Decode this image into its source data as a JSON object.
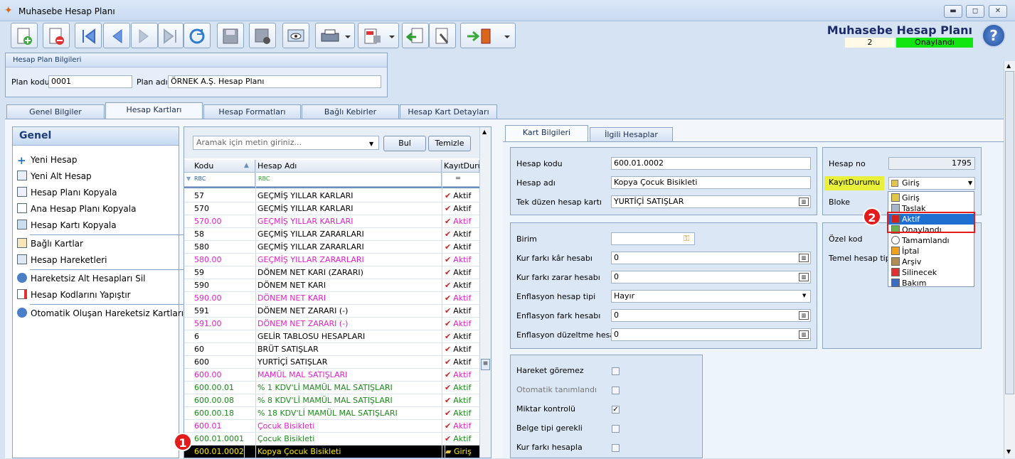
{
  "window": {
    "title": "Muhasebe Hesap Planı",
    "minimize": "▬",
    "maximize": "◻",
    "close": "✕"
  },
  "header": {
    "title": "Muhasebe Hesap Planı",
    "number": "2",
    "status": "Onaylandı",
    "help": "?"
  },
  "plan": {
    "section_title": "Hesap Plan Bilgileri",
    "code_label": "Plan kodu",
    "code_value": "0001",
    "name_label": "Plan adı",
    "name_value": "ÖRNEK A.Ş. Hesap Planı"
  },
  "tabs": [
    "Genel Bilgiler",
    "Hesap Kartları",
    "Hesap Formatları",
    "Bağlı Kebirler",
    "Hesap Kart Detayları"
  ],
  "sidebar": {
    "title": "Genel",
    "items": [
      "Yeni Hesap",
      "Yeni Alt Hesap",
      "Hesap Planı Kopyala",
      "Ana Hesap Planı Kopyala",
      "Hesap Kartı Kopyala",
      "Bağlı Kartlar",
      "Hesap Hareketleri",
      "Hareketsiz Alt Hesapları Sil",
      "Hesap Kodlarını Yapıştır",
      "Otomatik Oluşan Hareketsiz Kartları Sil"
    ]
  },
  "grid": {
    "search_placeholder": "Aramak için metin giriniz...",
    "find_button": "Bul",
    "clear_button": "Temizle",
    "columns": [
      "Kodu",
      "Hesap Adı",
      "KayıtDurur"
    ],
    "filter_icon": "RBC",
    "rows": [
      {
        "code": "57",
        "name": "GEÇMİŞ YILLAR KARLARI",
        "status": "Aktif",
        "color": "#000000"
      },
      {
        "code": "570",
        "name": "GEÇMİŞ YILLAR KARLARI",
        "status": "Aktif",
        "color": "#000000"
      },
      {
        "code": "570.00",
        "name": "GEÇMİŞ YILLAR KARLARI",
        "status": "Aktif",
        "color": "#e020c8"
      },
      {
        "code": "58",
        "name": "GEÇMİŞ YILLAR ZARARLARI",
        "status": "Aktif",
        "color": "#000000"
      },
      {
        "code": "580",
        "name": "GEÇMİŞ YILLAR ZARARLARI",
        "status": "Aktif",
        "color": "#000000"
      },
      {
        "code": "580.00",
        "name": "GEÇMİŞ YILLAR ZARARLARI",
        "status": "Aktif",
        "color": "#e020c8"
      },
      {
        "code": "59",
        "name": "DÖNEM NET KARI (ZARARI)",
        "status": "Aktif",
        "color": "#000000"
      },
      {
        "code": "590",
        "name": "DÖNEM NET KARI",
        "status": "Aktif",
        "color": "#000000"
      },
      {
        "code": "590.00",
        "name": "DÖNEM NET KARI",
        "status": "Aktif",
        "color": "#e020c8"
      },
      {
        "code": "591",
        "name": "DÖNEM NET ZARARI (-)",
        "status": "Aktif",
        "color": "#000000"
      },
      {
        "code": "591.00",
        "name": "DÖNEM NET ZARARI (-)",
        "status": "Aktif",
        "color": "#e020c8"
      },
      {
        "code": "6",
        "name": "GELİR TABLOSU HESAPLARI",
        "status": "Aktif",
        "color": "#000000"
      },
      {
        "code": "60",
        "name": "BRÜT SATIŞLAR",
        "status": "Aktif",
        "color": "#000000"
      },
      {
        "code": "600",
        "name": "YURTİÇİ SATIŞLAR",
        "status": "Aktif",
        "color": "#000000"
      },
      {
        "code": "600.00",
        "name": "MAMÜL MAL SATIŞLARI",
        "status": "Aktif",
        "color": "#e020c8"
      },
      {
        "code": "600.00.01",
        "name": "% 1 KDV'Lİ MAMÜL MAL SATIŞLARI",
        "status": "Aktif",
        "color": "#1a8a1a"
      },
      {
        "code": "600.00.08",
        "name": "% 8 KDV'Lİ MAMÜL MAL SATIŞLARI",
        "status": "Aktif",
        "color": "#1a8a1a"
      },
      {
        "code": "600.00.18",
        "name": "% 18 KDV'Lİ MAMÜL MAL SATIŞLARI",
        "status": "Aktif",
        "color": "#1a8a1a"
      },
      {
        "code": "600.01",
        "name": "Çocuk Bisikleti",
        "status": "Aktif",
        "color": "#e020c8"
      },
      {
        "code": "600.01.0001",
        "name": "Çocuk Bisikleti",
        "status": "Aktif",
        "color": "#1a8a1a"
      },
      {
        "code": "600.01.0002",
        "name": "Kopya Çocuk Bisikleti",
        "status": "Giriş",
        "color": "#ffee00"
      }
    ]
  },
  "detail": {
    "tabs": [
      "Kart Bilgileri",
      "İlgili Hesaplar"
    ],
    "hesap_kodu_label": "Hesap kodu",
    "hesap_kodu": "600.01.0002",
    "hesap_adi_label": "Hesap adı",
    "hesap_adi": "Kopya Çocuk Bisikleti",
    "tek_duzen_label": "Tek düzen hesap kartı",
    "tek_duzen": "YURTİÇİ SATIŞLAR",
    "hesap_no_label": "Hesap no",
    "hesap_no": "1795",
    "kayit_durumu_label": "KayıtDurumu",
    "kayit_durumu": "Giriş",
    "bloke_label": "Bloke",
    "birim_label": "Birim",
    "kur_kar_label": "Kur farkı kâr hesabı",
    "kur_kar": "0",
    "kur_zarar_label": "Kur farkı zarar hesabı",
    "kur_zarar": "0",
    "enf_tipi_label": "Enflasyon hesap tipi",
    "enf_tipi": "Hayır",
    "enf_fark_label": "Enflasyon fark hesabı",
    "enf_fark": "0",
    "enf_duz_label": "Enflasyon düzeltme hesabı",
    "enf_duz": "0",
    "ozel_kod_label": "Özel kod",
    "temel_tipi_label": "Temel hesap tipi",
    "checks": [
      {
        "label": "Hareket göremez",
        "checked": false,
        "dim": false
      },
      {
        "label": "Otomatik tanımlandı",
        "checked": false,
        "dim": true
      },
      {
        "label": "Miktar kontrolü",
        "checked": true,
        "dim": false
      },
      {
        "label": "Belge tipi gerekli",
        "checked": false,
        "dim": false
      },
      {
        "label": "Kur farkı hesapla",
        "checked": false,
        "dim": false
      }
    ]
  },
  "dropdown": {
    "options": [
      "Giriş",
      "Taslak",
      "Aktif",
      "Onaylandı",
      "Tamamlandı",
      "İptal",
      "Arşiv",
      "Silinecek",
      "Bakım"
    ],
    "highlighted": "Aktif"
  },
  "annotations": {
    "badge1": "1",
    "badge2": "2"
  }
}
